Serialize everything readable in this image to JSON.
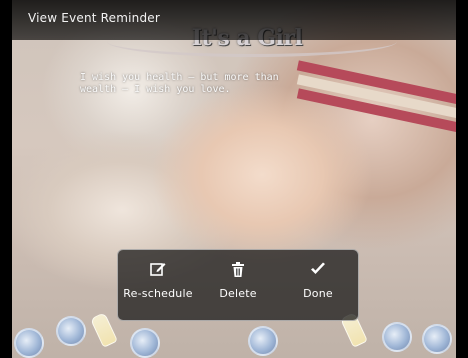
{
  "header": {
    "title": "View Event Reminder"
  },
  "photo": {
    "banner_text": "It's a Girl"
  },
  "reminder": {
    "message": "I wish you health –  but more than\nwealth – I wish you love."
  },
  "actions": [
    {
      "label": "Re-schedule",
      "icon": "edit-icon"
    },
    {
      "label": "Delete",
      "icon": "trash-icon"
    },
    {
      "label": "Done",
      "icon": "checkmark-icon"
    }
  ],
  "colors": {
    "overlay": "#141414",
    "text": "#ffffff"
  }
}
